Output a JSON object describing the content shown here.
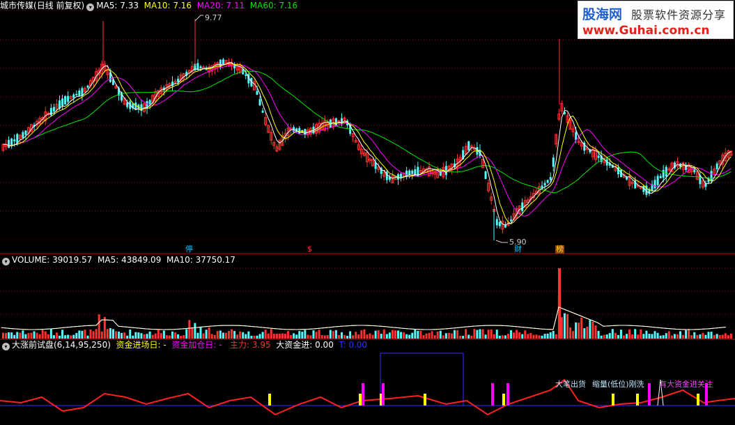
{
  "main_header": {
    "stock": "城市传媒",
    "period": "(日线 前复权)",
    "ma5": "MA5: 7.33",
    "ma10": "MA10: 7.16",
    "ma20": "MA20: 7.11",
    "ma60": "MA60: 7.16"
  },
  "price_annotations": {
    "high": "9.77",
    "low": "5.90"
  },
  "event_tags": {
    "t1": "停",
    "t2": "$",
    "t3": "财",
    "t4": "榜"
  },
  "volume_header": {
    "name": "VOLUME: 39019.57",
    "ma5": "MA5: 43849.09",
    "ma10": "MA10: 37750.17"
  },
  "indicator_header": {
    "name": "大涨前试盘(6,14,95,250)",
    "entry": "资金进场日: -",
    "add": "资金加仓日: -",
    "main": "主力: 3.95",
    "big": "大资金进: 0.00",
    "t": "T: 0.00"
  },
  "indicator_labels": {
    "a": "大笔出货",
    "b": "缩量(低位)刚洗",
    "c": "有大资金进关注"
  },
  "logo": {
    "line1": "股海网",
    "line1b": "股票软件资源分享",
    "line2": "www.Guhai.com.cn"
  },
  "colors": {
    "up": "#ff3232",
    "down": "#54fcfc",
    "ma5": "#ffffff",
    "ma10": "#ffff00",
    "ma20": "#ff00ff",
    "ma60": "#00e600",
    "grid": "#8b0000"
  }
}
